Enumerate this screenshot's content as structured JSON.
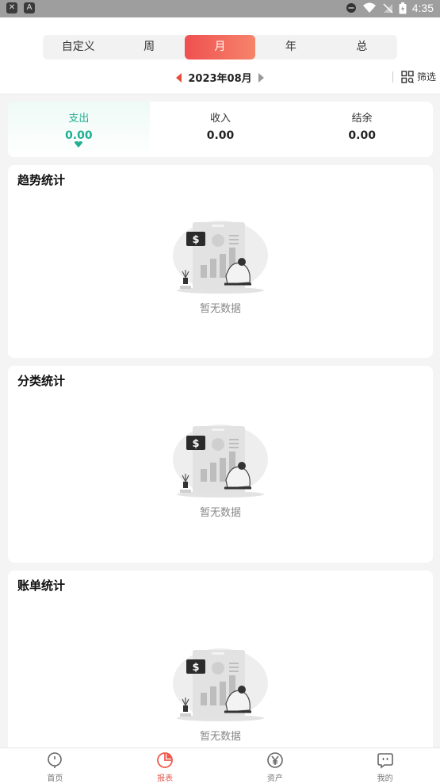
{
  "status_bar": {
    "time": "4:35",
    "left_icons": [
      "shield-icon",
      "a-icon"
    ]
  },
  "period_tabs": [
    {
      "label": "自定义",
      "active": false
    },
    {
      "label": "周",
      "active": false
    },
    {
      "label": "月",
      "active": true
    },
    {
      "label": "年",
      "active": false
    },
    {
      "label": "总",
      "active": false
    }
  ],
  "period": {
    "label": "2023年08月"
  },
  "filter": {
    "label": "筛选"
  },
  "summary": [
    {
      "label": "支出",
      "value": "0.00",
      "active": true
    },
    {
      "label": "收入",
      "value": "0.00",
      "active": false
    },
    {
      "label": "结余",
      "value": "0.00",
      "active": false
    }
  ],
  "sections": [
    {
      "title": "趋势统计",
      "empty_text": "暂无数据"
    },
    {
      "title": "分类统计",
      "empty_text": "暂无数据"
    },
    {
      "title": "账单统计",
      "empty_text": "暂无数据"
    }
  ],
  "bottom_nav": [
    {
      "label": "首页",
      "icon": "home-pin-icon",
      "active": false
    },
    {
      "label": "报表",
      "icon": "pie-chart-icon",
      "active": true
    },
    {
      "label": "资产",
      "icon": "yen-icon",
      "active": false
    },
    {
      "label": "我的",
      "icon": "face-icon",
      "active": false
    }
  ],
  "colors": {
    "accent": "#ef5a4f",
    "income_green": "#1fb091"
  }
}
